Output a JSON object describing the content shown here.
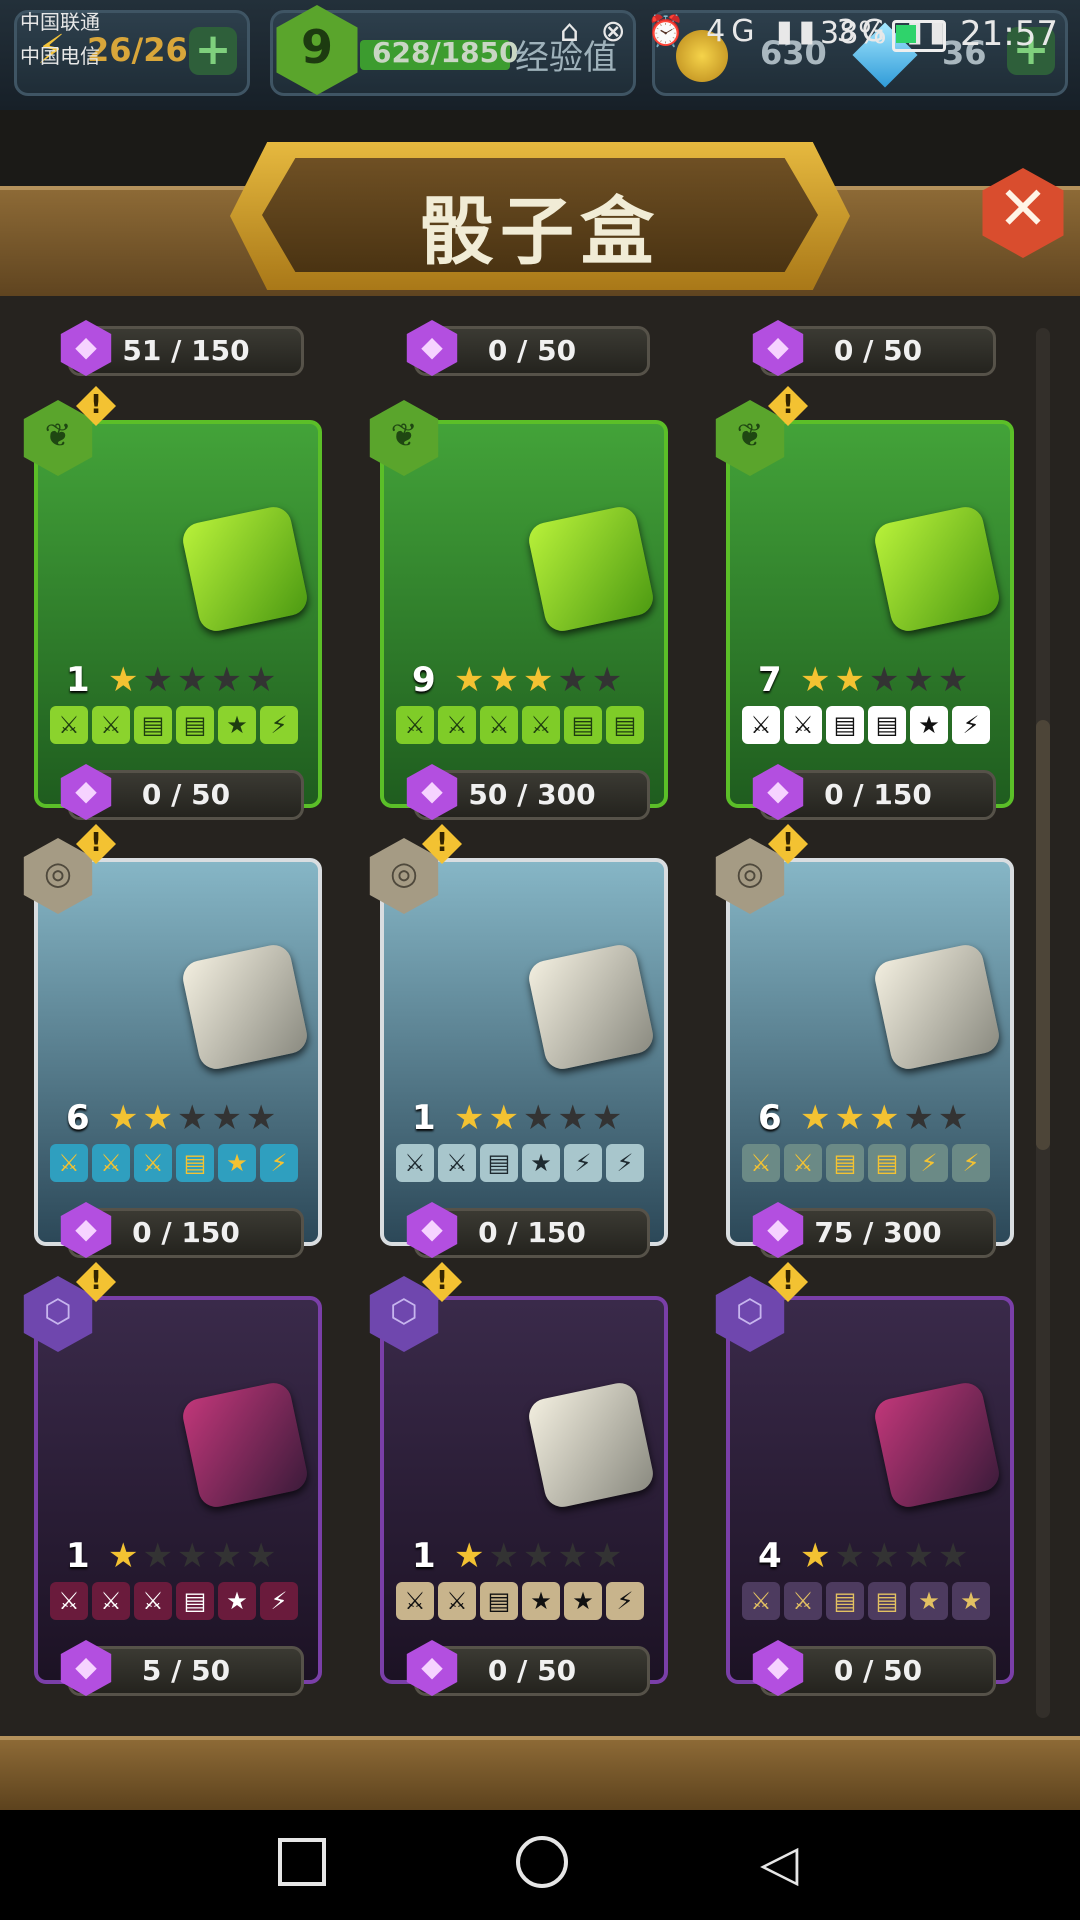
{
  "status_bar": {
    "carrier_1": "中国联通",
    "carrier_2": "中国电信",
    "icons": "⌂ ⊗ ⏰ 4G ▮▮ 3G ▮▮",
    "battery": "38%",
    "time": "21:57"
  },
  "top_bar": {
    "energy": "26/26",
    "level": "9",
    "xp": "628/1850",
    "xp_label": "经验值",
    "coins": "630",
    "gems": "36",
    "plus": "+"
  },
  "header": {
    "title": "骰子盒",
    "close_icon": "✕"
  },
  "top_progress": [
    {
      "value": "51 / 150"
    },
    {
      "value": "0 / 50"
    },
    {
      "value": "0 / 50"
    }
  ],
  "cards": [
    {
      "id": "c1",
      "theme": "green",
      "level": "1",
      "stars_on": "★",
      "stars_off": "★★★★",
      "faces": [
        "⚔",
        "⚔",
        "▤",
        "▤",
        "★",
        "⚡"
      ],
      "face_bg": "#8bd32d",
      "face_fg": "#1e3d10",
      "progress": "0 / 50",
      "hex_icon": "❦",
      "alert": "!"
    },
    {
      "id": "c2",
      "theme": "green",
      "level": "9",
      "stars_on": "★★★",
      "stars_off": "★★",
      "faces": [
        "⚔",
        "⚔",
        "⚔",
        "⚔",
        "▤",
        "▤"
      ],
      "face_bg": "#7fcc28",
      "face_fg": "#1e3d10",
      "progress": "50 / 300",
      "hex_icon": "❦",
      "alert": ""
    },
    {
      "id": "c3",
      "theme": "green",
      "level": "7",
      "stars_on": "★★",
      "stars_off": "★★★",
      "faces": [
        "⚔",
        "⚔",
        "▤",
        "▤",
        "★",
        "⚡"
      ],
      "face_bg": "#ffffff",
      "face_fg": "#111111",
      "progress": "0 / 150",
      "hex_icon": "❦",
      "alert": "!"
    },
    {
      "id": "c4",
      "theme": "white",
      "level": "6",
      "stars_on": "★★",
      "stars_off": "★★★",
      "faces": [
        "⚔",
        "⚔",
        "⚔",
        "▤",
        "★",
        "⚡"
      ],
      "face_bg": "#2f9fbf",
      "face_fg": "#f3c232",
      "progress": "0 / 150",
      "hex_icon": "◎",
      "alert": "!"
    },
    {
      "id": "c5",
      "theme": "white",
      "level": "1",
      "stars_on": "★★",
      "stars_off": "★★★",
      "faces": [
        "⚔",
        "⚔",
        "▤",
        "★",
        "⚡",
        "⚡"
      ],
      "face_bg": "#a8c6cc",
      "face_fg": "#1e2a30",
      "progress": "0 / 150",
      "hex_icon": "◎",
      "alert": "!"
    },
    {
      "id": "c6",
      "theme": "white",
      "level": "6",
      "stars_on": "★★★",
      "stars_off": "★★",
      "faces": [
        "⚔",
        "⚔",
        "▤",
        "▤",
        "⚡",
        "⚡"
      ],
      "face_bg": "#6b8a86",
      "face_fg": "#f3c232",
      "progress": "75 / 300",
      "hex_icon": "◎",
      "alert": "!"
    },
    {
      "id": "c7",
      "theme": "purple",
      "level": "1",
      "stars_on": "★",
      "stars_off": "★★★★",
      "faces": [
        "⚔",
        "⚔",
        "⚔",
        "▤",
        "★",
        "⚡"
      ],
      "face_bg": "#6a1b3c",
      "face_fg": "#ffffff",
      "progress": "5 / 50",
      "hex_icon": "⬡",
      "alert": "!"
    },
    {
      "id": "c8",
      "theme": "purple",
      "level": "1",
      "stars_on": "★",
      "stars_off": "★★★★",
      "faces": [
        "⚔",
        "⚔",
        "▤",
        "★",
        "★",
        "⚡"
      ],
      "face_bg": "#c8b48c",
      "face_fg": "#111111",
      "progress": "0 / 50",
      "hex_icon": "⬡",
      "alert": "!"
    },
    {
      "id": "c9",
      "theme": "purple",
      "level": "4",
      "stars_on": "★",
      "stars_off": "★★★★",
      "faces": [
        "⚔",
        "⚔",
        "▤",
        "▤",
        "★",
        "★"
      ],
      "face_bg": "#4d3b5f",
      "face_fg": "#e2c062",
      "progress": "0 / 50",
      "hex_icon": "⬡",
      "alert": "!"
    }
  ]
}
